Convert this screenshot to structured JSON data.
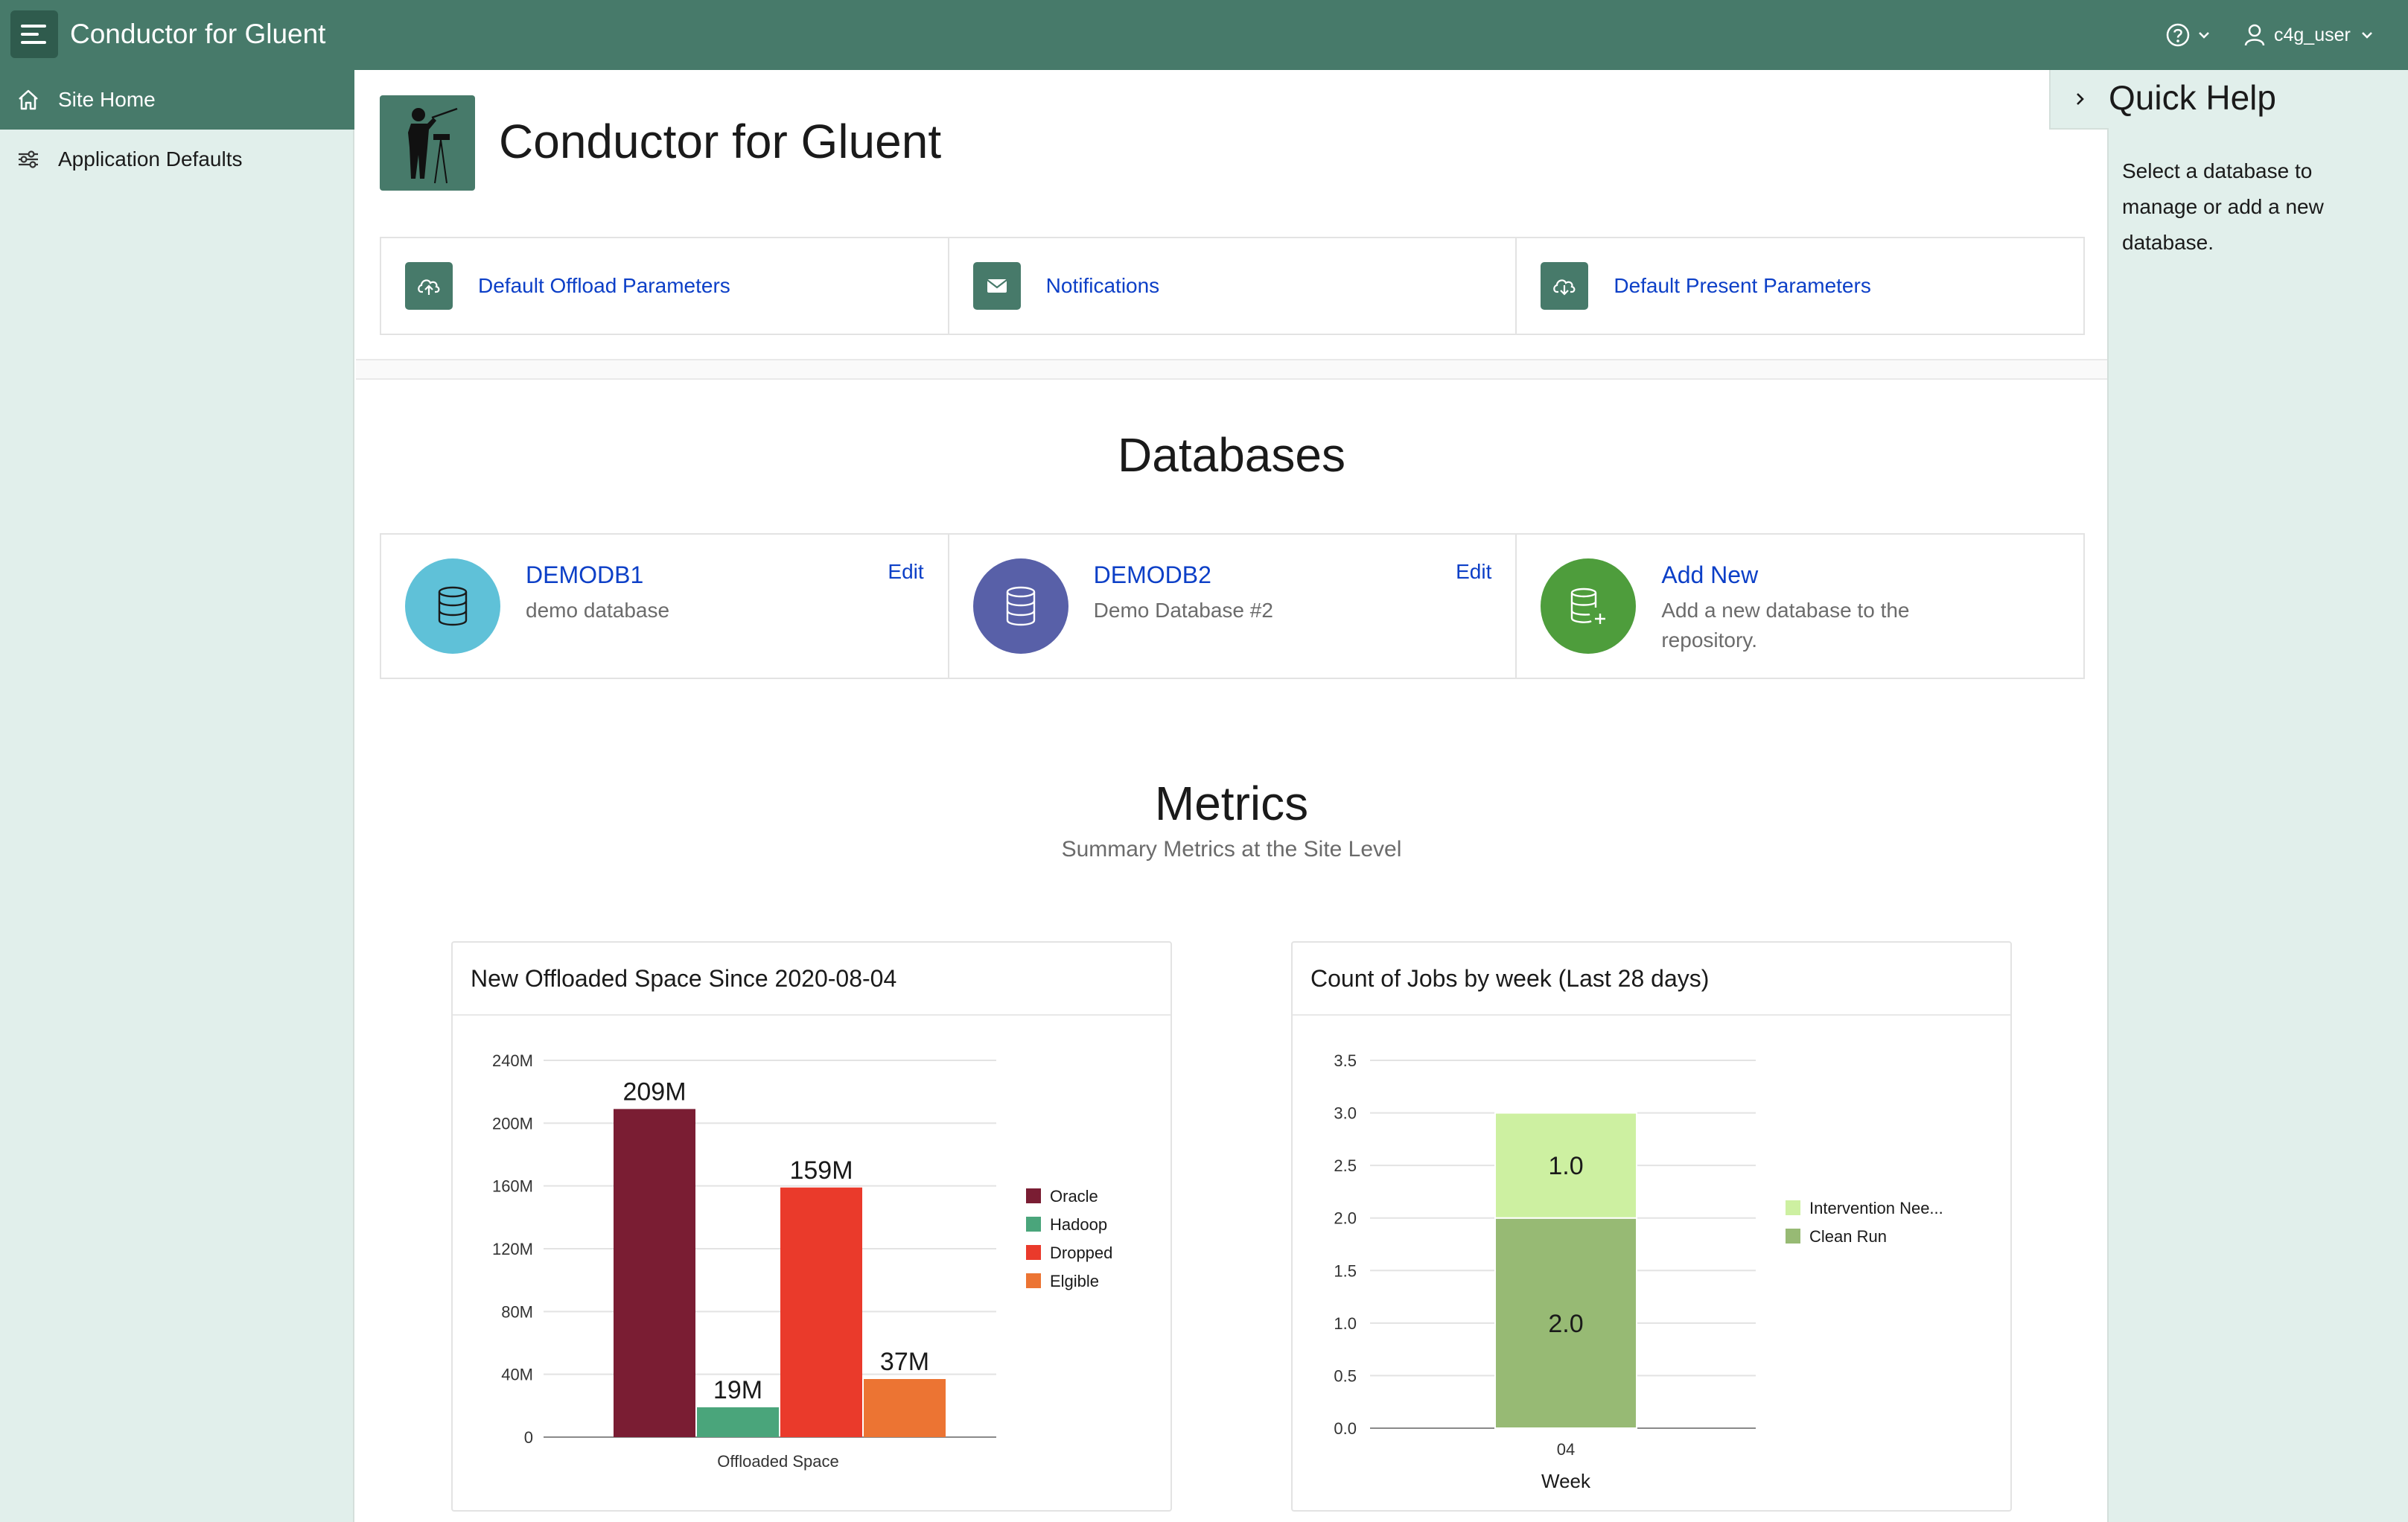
{
  "header": {
    "app_title": "Conductor for Gluent",
    "user_name": "c4g_user"
  },
  "sidebar": {
    "items": [
      {
        "label": "Site Home",
        "icon": "home-icon"
      },
      {
        "label": "Application Defaults",
        "icon": "sliders-icon"
      }
    ]
  },
  "hero": {
    "title": "Conductor for Gluent"
  },
  "quick_links": [
    {
      "label": "Default Offload Parameters",
      "icon": "cloud-upload-icon"
    },
    {
      "label": "Notifications",
      "icon": "mail-icon"
    },
    {
      "label": "Default Present Parameters",
      "icon": "cloud-download-icon"
    }
  ],
  "databases": {
    "title": "Databases",
    "cards": [
      {
        "name": "DEMODB1",
        "description": "demo database",
        "edit_label": "Edit",
        "color": "#5fc1d8"
      },
      {
        "name": "DEMODB2",
        "description": "Demo Database #2",
        "edit_label": "Edit",
        "color": "#5860a8"
      },
      {
        "name": "Add New",
        "description": "Add a new database to the repository.",
        "color": "#4e9d3c"
      }
    ]
  },
  "metrics": {
    "title": "Metrics",
    "subtitle": "Summary Metrics at the Site Level"
  },
  "quick_help": {
    "title": "Quick Help",
    "text": "Select a database to manage or add a new database."
  },
  "chart_data": [
    {
      "type": "bar",
      "title": "New Offloaded Space Since 2020-08-04",
      "xlabel": "Offloaded Space",
      "ylabel": "",
      "ylim": [
        0,
        240
      ],
      "yticks": [
        "0",
        "40M",
        "80M",
        "120M",
        "160M",
        "200M",
        "240M"
      ],
      "ytick_values": [
        0,
        40,
        80,
        120,
        160,
        200,
        240
      ],
      "grid": true,
      "legend_position": "right",
      "series": [
        {
          "name": "Oracle",
          "value": 209,
          "label": "209M",
          "color": "#7a1d33"
        },
        {
          "name": "Hadoop",
          "value": 19,
          "label": "19M",
          "color": "#4aa57b"
        },
        {
          "name": "Dropped",
          "value": 159,
          "label": "159M",
          "color": "#ea3a2b"
        },
        {
          "name": "Elgible",
          "value": 37,
          "label": "37M",
          "color": "#ec7433"
        }
      ]
    },
    {
      "type": "bar",
      "stacked": true,
      "title": "Count of Jobs by week (Last 28 days)",
      "xlabel": "Week",
      "ylabel": "",
      "categories": [
        "04"
      ],
      "ylim": [
        0,
        3.5
      ],
      "yticks": [
        "0.0",
        "0.5",
        "1.0",
        "1.5",
        "2.0",
        "2.5",
        "3.0",
        "3.5"
      ],
      "ytick_values": [
        0,
        0.5,
        1.0,
        1.5,
        2.0,
        2.5,
        3.0,
        3.5
      ],
      "grid": true,
      "legend_position": "right",
      "series": [
        {
          "name": "Clean Run",
          "values": [
            2.0
          ],
          "label": "2.0",
          "color": "#97ba74"
        },
        {
          "name": "Intervention Nee...",
          "values": [
            1.0
          ],
          "label": "1.0",
          "color": "#cdf0a1"
        }
      ]
    }
  ]
}
